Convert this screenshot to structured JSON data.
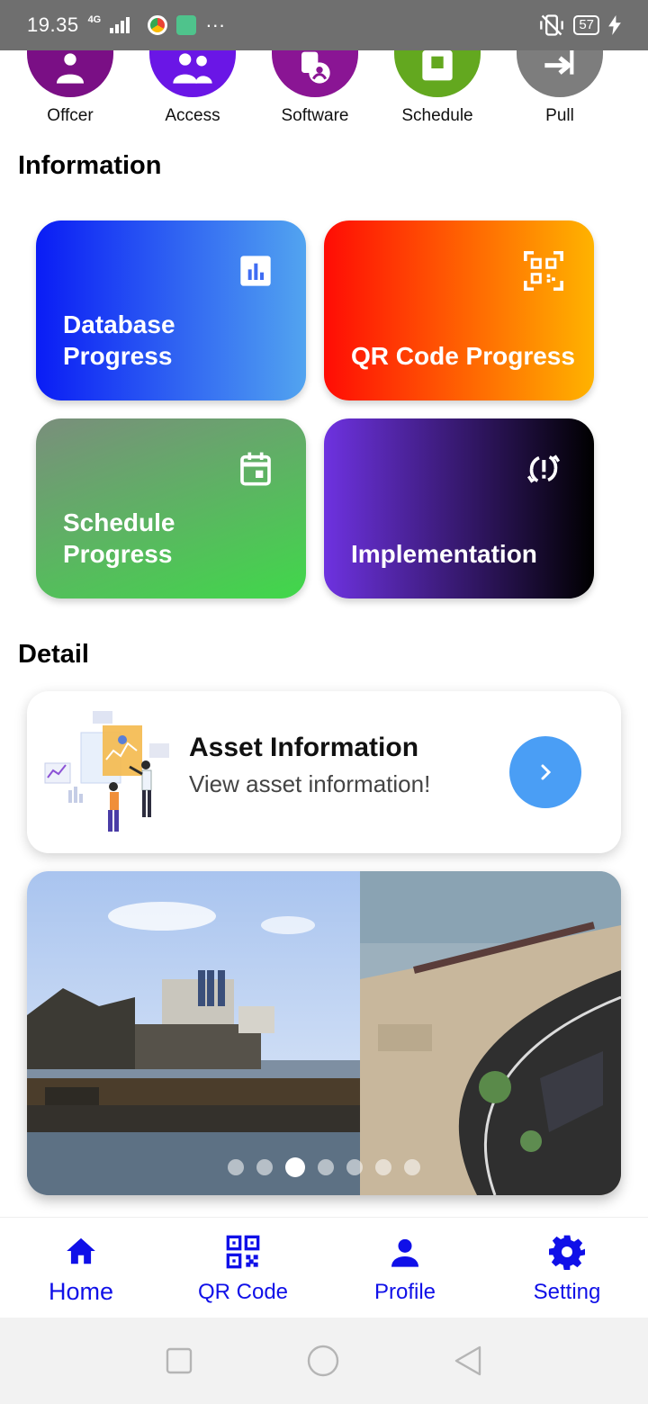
{
  "status_bar": {
    "time": "19.35",
    "network": "4G",
    "battery": "57"
  },
  "categories": [
    {
      "label": "Offcer",
      "color": "#7a0f85",
      "icon": "person-icon"
    },
    {
      "label": "Access",
      "color": "#6a16e6",
      "icon": "people-icon"
    },
    {
      "label": "Software",
      "color": "#8a1594",
      "icon": "software-icon"
    },
    {
      "label": "Schedule",
      "color": "#63a81f",
      "icon": "schedule-icon"
    },
    {
      "label": "Pull",
      "color": "#7d7d7d",
      "icon": "pull-icon"
    }
  ],
  "sections": {
    "information": "Information",
    "detail": "Detail"
  },
  "info_cards": [
    {
      "title": "Database Progress",
      "icon": "bar-chart-icon",
      "gradient": [
        "#0a1cf5",
        "#52a4f0"
      ]
    },
    {
      "title": "QR Code Progress",
      "icon": "qr-scan-icon",
      "gradient": [
        "#ff0c05",
        "#ffb300"
      ]
    },
    {
      "title": "Schedule Progress",
      "icon": "calendar-icon",
      "gradient": [
        "#7a8e7c",
        "#40d84a"
      ]
    },
    {
      "title": "Implementation",
      "icon": "sync-problem-icon",
      "gradient": [
        "#6e32e0",
        "#000000"
      ]
    }
  ],
  "asset": {
    "title": "Asset Information",
    "subtitle": "View asset information!"
  },
  "carousel": {
    "dot_count": 7,
    "active_index": 2
  },
  "bottom_nav": [
    {
      "label": "Home",
      "icon": "home-icon",
      "active": true
    },
    {
      "label": "QR Code",
      "icon": "qr-code-icon",
      "active": false
    },
    {
      "label": "Profile",
      "icon": "profile-icon",
      "active": false
    },
    {
      "label": "Setting",
      "icon": "gear-icon",
      "active": false
    }
  ],
  "colors": {
    "nav_accent": "#1010e8",
    "asset_button": "#4a9ef5"
  }
}
